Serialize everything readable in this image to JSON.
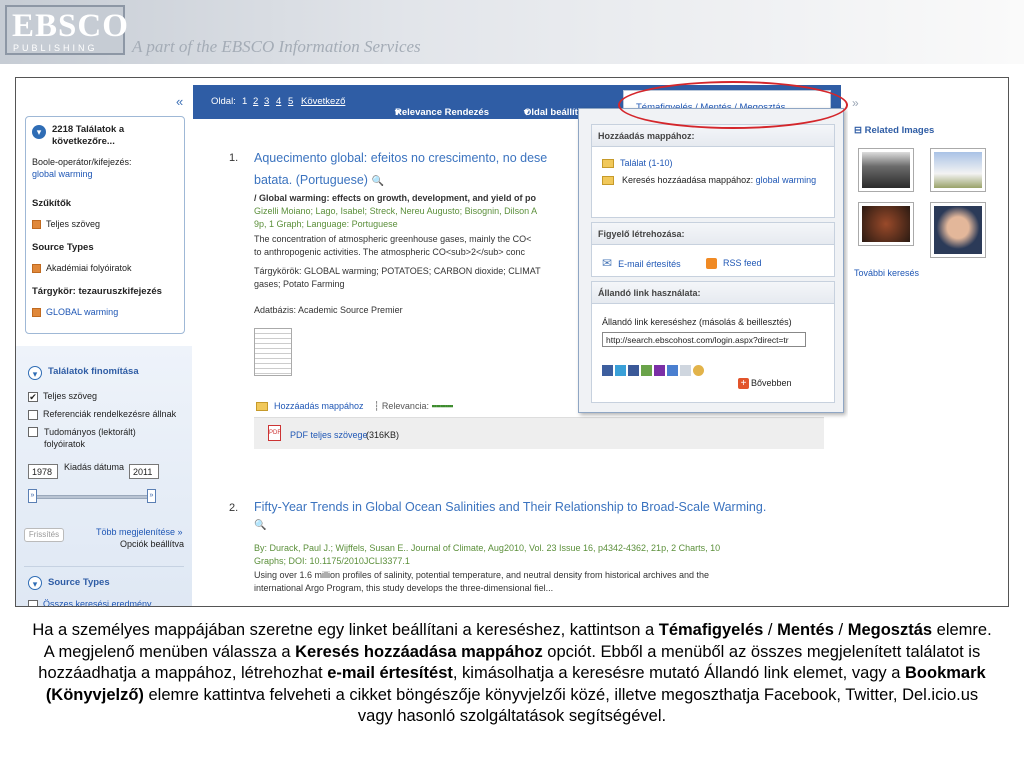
{
  "header": {
    "logo_main": "EBSCO",
    "logo_sub": "PUBLISHING",
    "tagline": "A part of the EBSCO Information Services"
  },
  "left": {
    "collapse_glyph": "«",
    "summary_title": "2218 Találatok a következőre...",
    "bool_label": "Boole-operátor/kifejezés:",
    "query": "global warming",
    "narrow_label": "Szűkítők",
    "narrow_item": "Teljes szöveg",
    "source_types_label": "Source Types",
    "source_item": "Akadémiai folyóiratok",
    "subject_label": "Tárgykör: tezauruszkifejezés",
    "subject_item": "GLOBAL warming",
    "refine_label": "Találatok finomítása",
    "refine_checks": [
      {
        "label": "Teljes szöveg",
        "checked": true
      },
      {
        "label": "Referenciák rendelkezésre állnak",
        "checked": false
      },
      {
        "label": "Tudományos (lektorált) folyóiratok",
        "checked": false
      }
    ],
    "date_from": "1978",
    "date_label": "Kiadás dátuma",
    "date_to": "2011",
    "update_button": "Frissítés",
    "more_link": "Több megjelenítése »",
    "options_link": "Opciók beállítva",
    "source_types2": "Source Types",
    "all_results": "Összes keresési eredmény"
  },
  "toolbar": {
    "page_label": "Oldal:",
    "pages": [
      "1",
      "2",
      "3",
      "4",
      "5"
    ],
    "next": "Következő",
    "sort": "Relevance Rendezés",
    "page_options": "Oldal beállításai",
    "share": "Témafigyelés / Mentés / Megosztás",
    "right_toggle": "»"
  },
  "results": [
    {
      "num": "1.",
      "title_line1": "Aquecimento global: efeitos no crescimento, no dese",
      "title_line2": "batata. (Portuguese)",
      "lines": [
        "/ Global warming: effects on growth, development, and yield of po",
        "Gizelli Moiano; Lago, Isabel; Streck, Nereu Augusto; Bisognin, Dilson A",
        "9p, 1 Graph; Language: Portuguese",
        "The concentration of atmospheric greenhouse gases, mainly the CO<",
        "to anthropogenic activities. The atmospheric CO<sub>2</sub> conc",
        "Tárgykörök: GLOBAL warming; POTATOES; CARBON dioxide; CLIMAT",
        "gases; Potato Farming",
        "Adatbázis: Academic Source Premier"
      ],
      "folder_link": "Hozzáadás mappához",
      "relevance_label": "Relevancia:",
      "pdf_link": "PDF teljes szövege",
      "pdf_size": "(316KB)"
    },
    {
      "num": "2.",
      "title": "Fifty-Year Trends in Global Ocean Salinities and Their Relationship to Broad-Scale Warming.",
      "byline": "By: Durack, Paul J.; Wijffels, Susan E.. Journal of Climate, Aug2010, Vol. 23 Issue 16, p4342-4362, 21p, 2 Charts, 10",
      "byline2": "Graphs; DOI: 10.1175/2010JCLI3377.1",
      "abstract1": "Using over 1.6 million profiles of salinity, potential temperature, and neutral density from historical archives and the",
      "abstract2": "international Argo Program, this study develops the three-dimensional fiel..."
    }
  ],
  "dropdown": {
    "add_header": "Hozzáadás mappához:",
    "add_item1": "Találat (1-10)",
    "add_item2_prefix": "Keresés hozzáadása mappához:",
    "add_item2_link": "global warming",
    "alert_header": "Figyelő létrehozása:",
    "email_alert": "E-mail értesítés",
    "rss": "RSS feed",
    "link_header": "Állandó link használata:",
    "link_desc": "Állandó link kereséshez (másolás & beillesztés)",
    "link_value": "http://search.ebscohost.com/login.aspx?direct=tr",
    "more": "Bővebben"
  },
  "right": {
    "related_images": "Related Images",
    "more_search": "További keresés"
  },
  "caption": {
    "p1": "Ha a személyes mappájában szeretne egy linket beállítani a kereséshez, kattintson a ",
    "b1": "Témafigyelés",
    "p2": " / ",
    "b2": "Mentés",
    "p3": " / ",
    "b3": "Megosztás",
    "p4": " elemre. A megjelenő menüben válassza a ",
    "b4": "Keresés hozzáadása mappához",
    "p5": " opciót. Ebből a menüből az összes megjelenített találatot is hozzáadhatja a mappához, létrehozhat ",
    "b5": "e-mail értesítést",
    "p6": ", kimásolhatja a keresésre mutató Állandó link elemet, vagy a ",
    "b6": "Bookmark (Könyvjelző)",
    "p7": " elemre kattintva felveheti a cikket böngészője könyvjelzői közé, illetve megoszthatja Facebook, Twitter, Del.icio.us vagy hasonló szolgáltatások segítségével."
  }
}
